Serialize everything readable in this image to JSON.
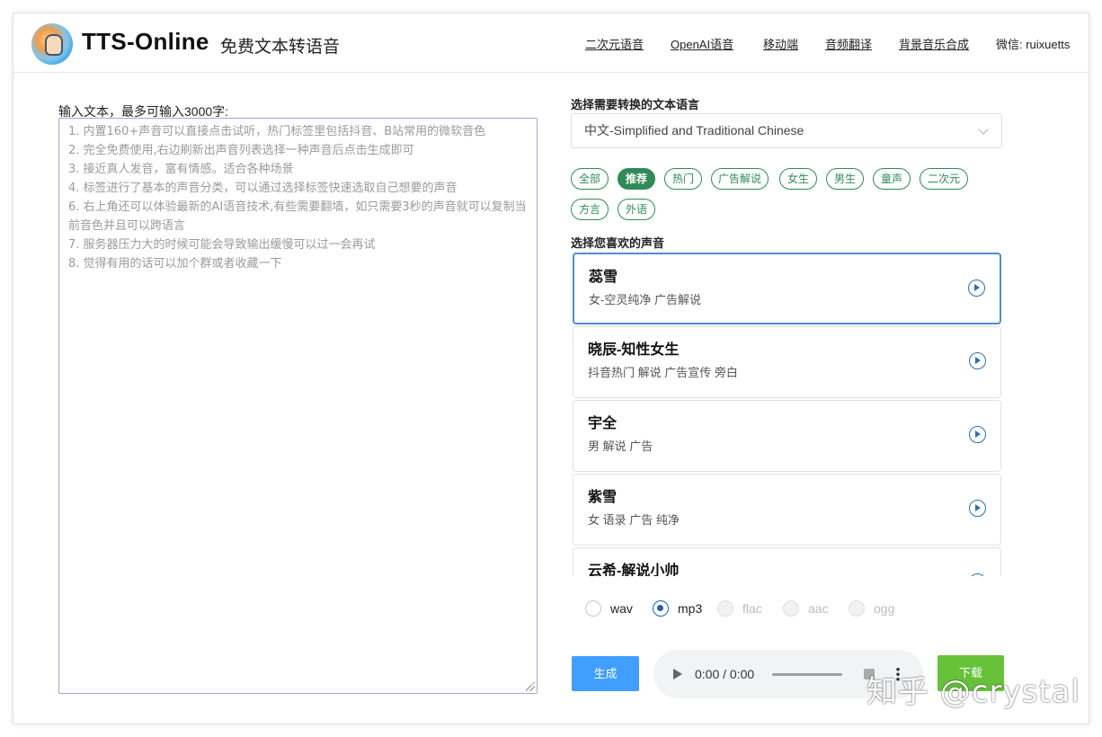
{
  "header": {
    "brand": "TTS-Online",
    "subtitle": "免费文本转语音",
    "nav": [
      "二次元语音",
      "OpenAI语音",
      "移动端",
      "音频翻译",
      "背景音乐合成"
    ],
    "wechat": "微信: ruixuetts"
  },
  "left": {
    "input_label": "输入文本，最多可输入3000字:",
    "placeholder_lines": [
      "1. 内置160+声音可以直接点击试听，热门标签里包括抖音、B站常用的微软音色",
      "2. 完全免费使用,右边刷新出声音列表选择一种声音后点击生成即可",
      "3. 接近真人发音，富有情感。适合各种场景",
      "4. 标签进行了基本的声音分类，可以通过选择标签快速选取自己想要的声音",
      "6. 右上角还可以体验最新的AI语音技术,有些需要翻墙，如只需要3秒的声音就可以复制当前音色并且可以跨语言",
      "7. 服务器压力大的时候可能会导致输出缓慢可以过一会再试",
      "8. 觉得有用的话可以加个群或者收藏一下"
    ]
  },
  "right": {
    "language_label": "选择需要转换的文本语言",
    "language_value": "中文-Simplified and Traditional Chinese",
    "tags": [
      {
        "label": "全部",
        "active": false
      },
      {
        "label": "推荐",
        "active": true
      },
      {
        "label": "热门",
        "active": false
      },
      {
        "label": "广告解说",
        "active": false
      },
      {
        "label": "女生",
        "active": false
      },
      {
        "label": "男生",
        "active": false
      },
      {
        "label": "童声",
        "active": false
      },
      {
        "label": "二次元",
        "active": false
      },
      {
        "label": "方言",
        "active": false
      },
      {
        "label": "外语",
        "active": false
      }
    ],
    "voice_label": "选择您喜欢的声音",
    "voices": [
      {
        "name": "蕊雪",
        "desc": "女-空灵纯净 广告解说",
        "selected": true
      },
      {
        "name": "晓辰-知性女生",
        "desc": "抖音热门 解说 广告宣传 旁白",
        "selected": false
      },
      {
        "name": "宇全",
        "desc": "男 解说 广告",
        "selected": false
      },
      {
        "name": "紫雪",
        "desc": "女 语录 广告 纯净",
        "selected": false
      },
      {
        "name": "云希-解说小帅",
        "desc": "",
        "selected": false
      }
    ],
    "formats": [
      {
        "label": "wav",
        "checked": false,
        "disabled": false
      },
      {
        "label": "mp3",
        "checked": true,
        "disabled": false
      },
      {
        "label": "flac",
        "checked": false,
        "disabled": true
      },
      {
        "label": "aac",
        "checked": false,
        "disabled": true
      },
      {
        "label": "ogg",
        "checked": false,
        "disabled": true
      }
    ],
    "generate_label": "生成",
    "player_time": "0:00 / 0:00",
    "download_label": "下载"
  },
  "watermark": "知乎 @crystal",
  "colors": {
    "tag_green": "#2e8b57",
    "generate_blue": "#409eff",
    "download_green": "#67c23a",
    "selected_border": "#4f8fcf"
  }
}
